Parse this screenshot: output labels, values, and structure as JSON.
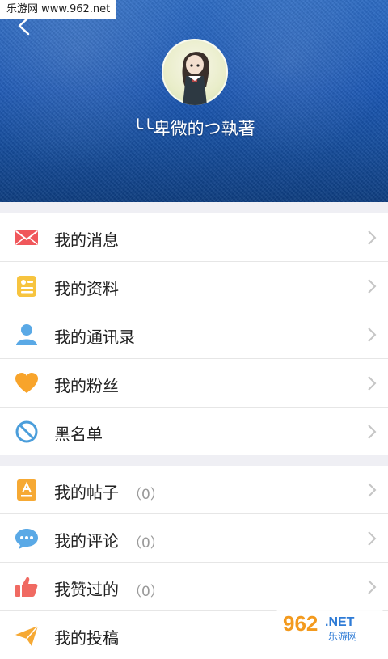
{
  "watermark": {
    "site": "乐游网 www.962.net",
    "logo_main": "962",
    "logo_net": ".NET",
    "logo_sub": "乐游网"
  },
  "header": {
    "username": "╰╰卑微的つ執著"
  },
  "menu_group_1": [
    {
      "label": "我的消息",
      "icon": "mail-icon"
    },
    {
      "label": "我的资料",
      "icon": "profile-card-icon"
    },
    {
      "label": "我的通讯录",
      "icon": "contact-icon"
    },
    {
      "label": "我的粉丝",
      "icon": "heart-icon"
    },
    {
      "label": "黑名单",
      "icon": "block-icon"
    }
  ],
  "menu_group_2": [
    {
      "label": "我的帖子",
      "count": "（0）",
      "icon": "post-icon"
    },
    {
      "label": "我的评论",
      "count": "（0）",
      "icon": "comment-icon"
    },
    {
      "label": "我赞过的",
      "count": "（0）",
      "icon": "thumb-up-icon"
    },
    {
      "label": "我的投稿",
      "icon": "send-icon"
    }
  ],
  "colors": {
    "mail": "#f0575b",
    "profile": "#f7c43f",
    "contact": "#5aa9e6",
    "heart": "#f8a42b",
    "block": "#4b9edb",
    "post": "#f6a934",
    "comment": "#5aa9e6",
    "thumb": "#f06a62",
    "send": "#f6a934"
  }
}
